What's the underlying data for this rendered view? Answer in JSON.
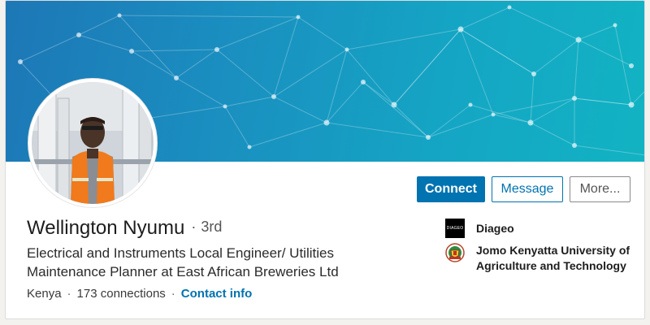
{
  "profile": {
    "name": "Wellington Nyumu",
    "degree_separator": "·",
    "degree": "3rd",
    "headline": "Electrical and Instruments Local Engineer/ Utilities Maintenance Planner at East African Breweries Ltd",
    "location": "Kenya",
    "meta_separator": "·",
    "connections": "173 connections",
    "contact_link": "Contact info"
  },
  "actions": {
    "connect_label": "Connect",
    "message_label": "Message",
    "more_label": "More..."
  },
  "experience": {
    "company_name": "Diageo",
    "company_logo_text": "DIAGEO",
    "school_name": "Jomo Kenyatta University of Agriculture and Technology"
  },
  "colors": {
    "brand_blue": "#0073b1",
    "banner_start": "#1d77b6",
    "banner_end": "#12b3c3"
  },
  "icons": {
    "company_logo": "diageo-logo-icon",
    "school_logo": "university-crest-icon",
    "avatar": "profile-photo"
  }
}
